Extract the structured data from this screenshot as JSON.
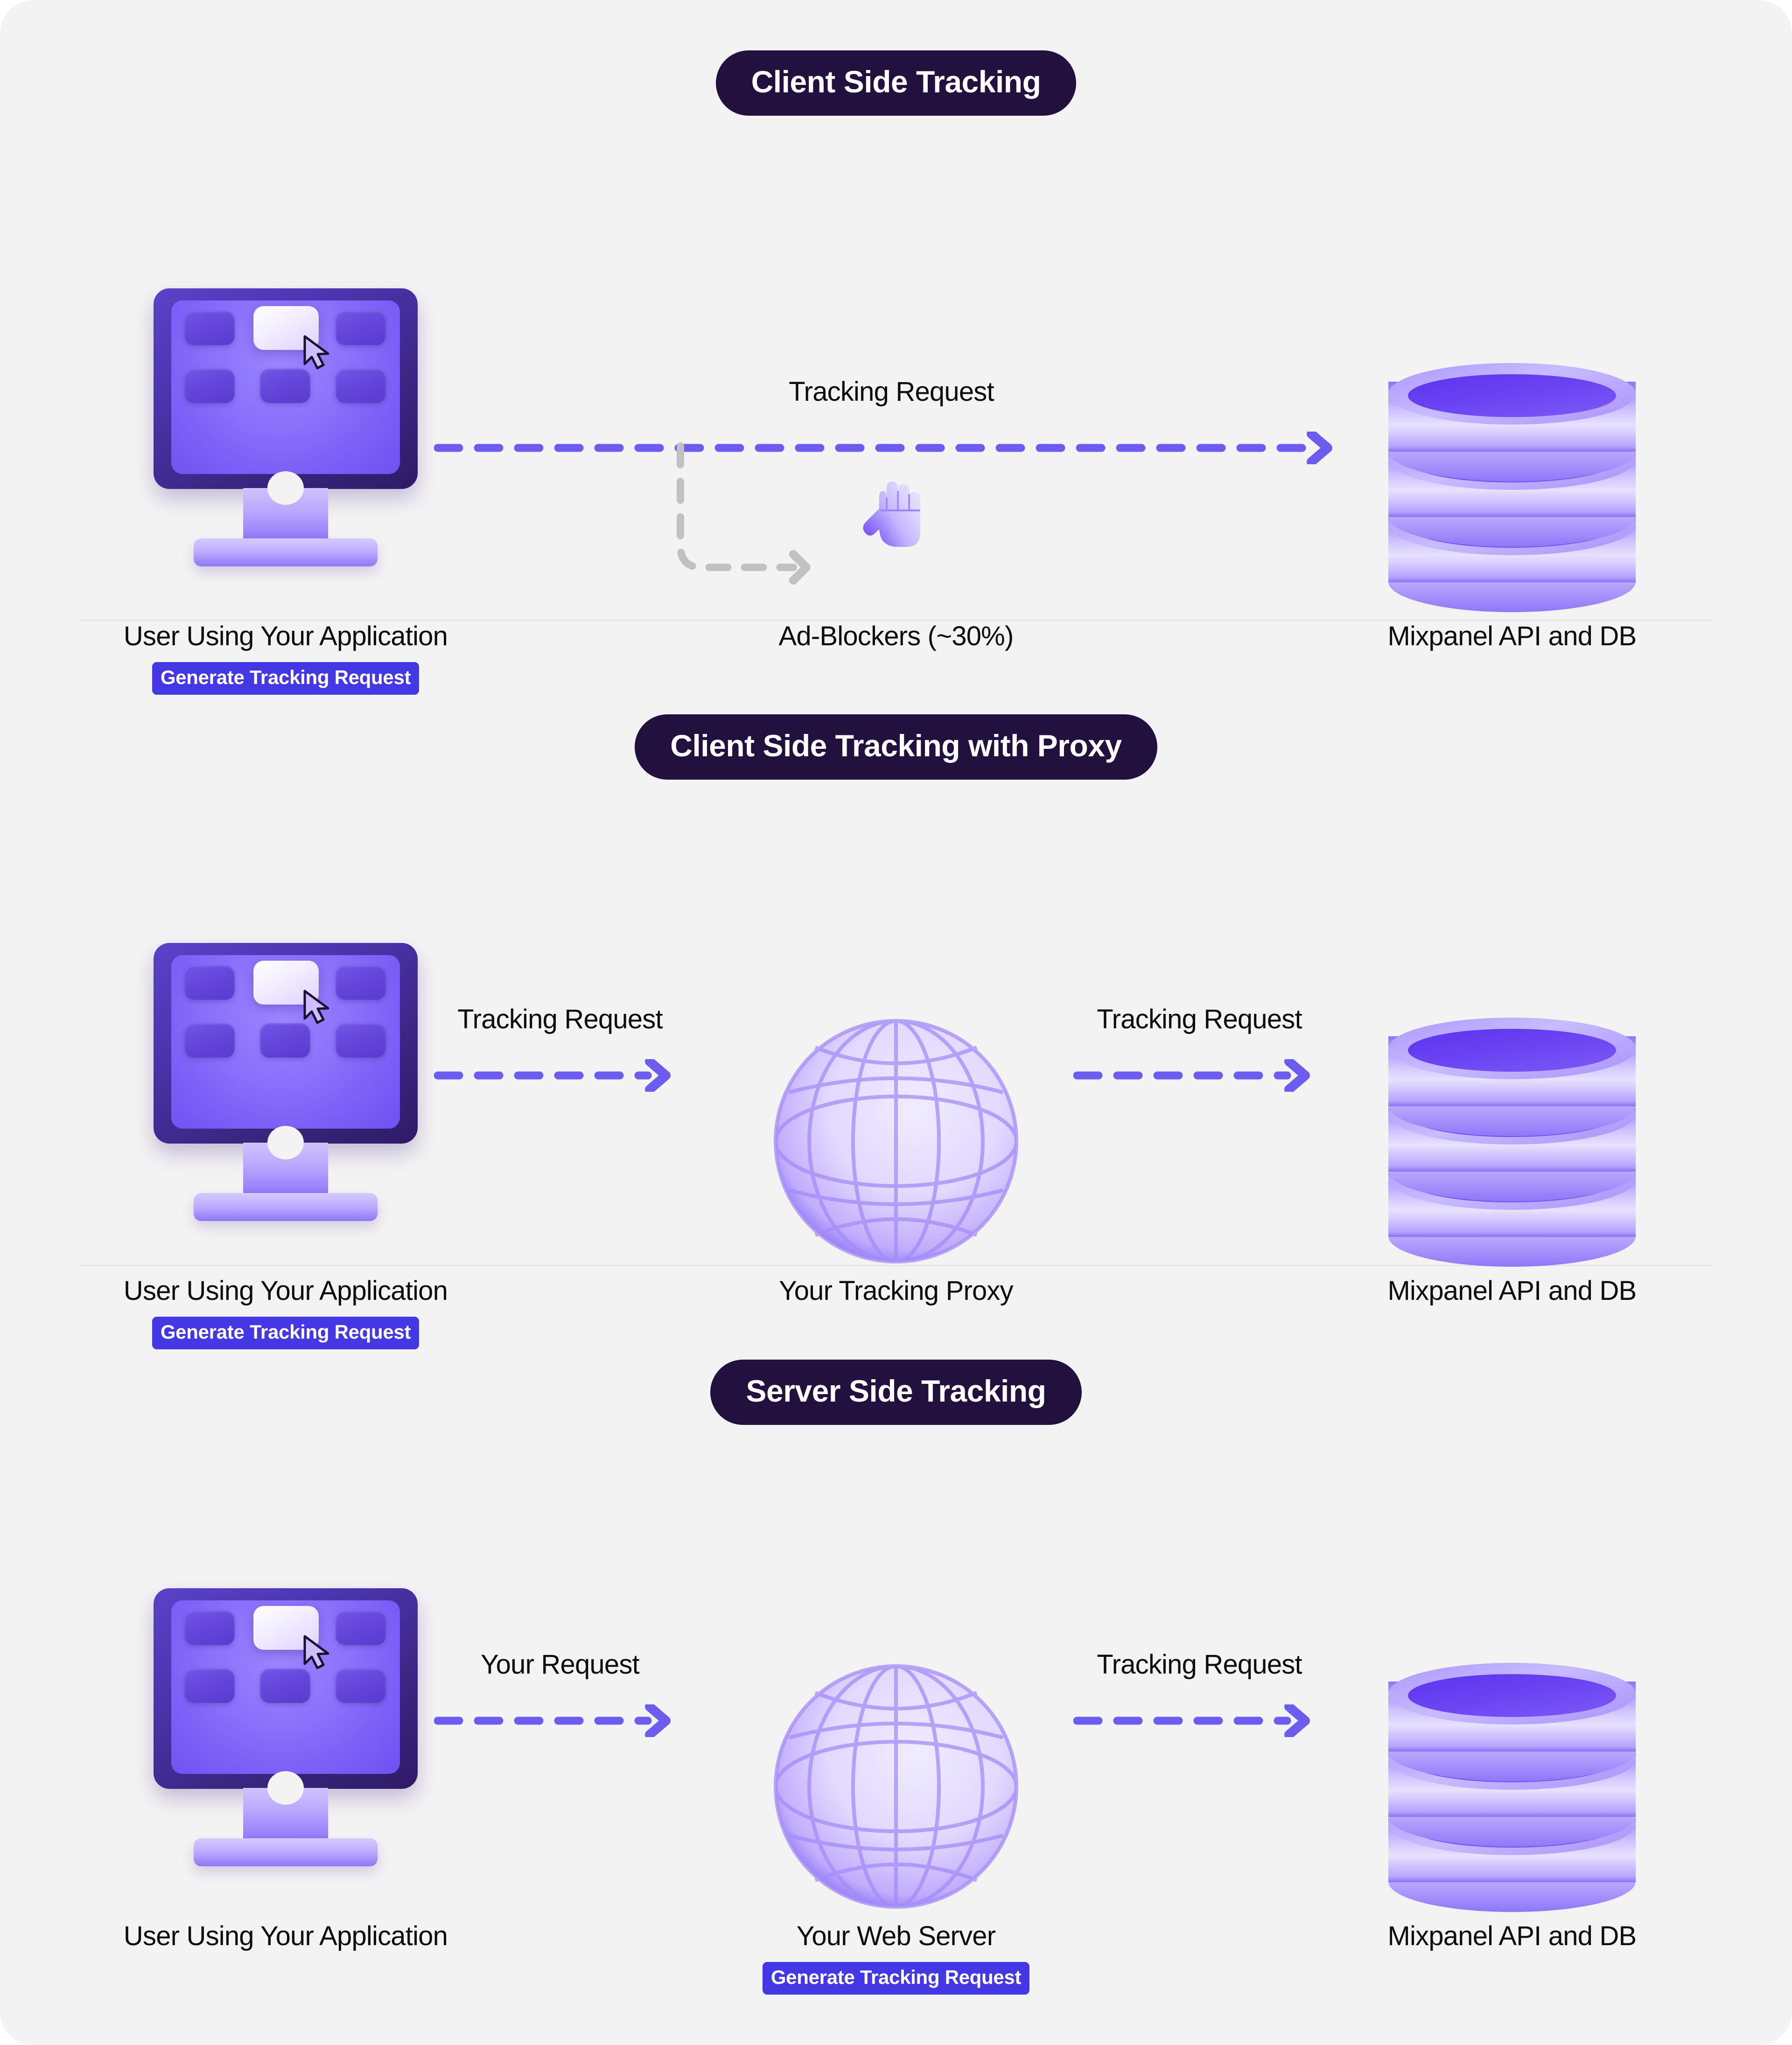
{
  "page": {
    "background": "#f4f3f4",
    "accent_purple": "#6d5cf0",
    "badge_color": "#4338e3",
    "pill_color": "#22113f",
    "gray_arrow_color": "#c2c0c2",
    "text_color": "#0d0d0d"
  },
  "sections": [
    {
      "title": "Client Side Tracking",
      "nodes": {
        "left": {
          "icon": "monitor-icon",
          "label": "User Using Your Application",
          "badge": "Generate Tracking Request"
        },
        "middle": {
          "icon": "stop-hand-icon",
          "label": "Ad-Blockers (~30%)",
          "badge": null
        },
        "right": {
          "icon": "database-icon",
          "label": "Mixpanel API and DB",
          "badge": null
        }
      },
      "arrows": [
        {
          "label": "Tracking Request",
          "style": "dashed-purple",
          "span": "left-to-right"
        },
        {
          "label": "",
          "style": "dashed-gray-branch",
          "span": "branch-to-adblocker"
        }
      ]
    },
    {
      "title": "Client Side Tracking with Proxy",
      "nodes": {
        "left": {
          "icon": "monitor-icon",
          "label": "User Using Your Application",
          "badge": "Generate Tracking Request"
        },
        "middle": {
          "icon": "globe-icon",
          "label": "Your Tracking Proxy",
          "badge": null
        },
        "right": {
          "icon": "database-icon",
          "label": "Mixpanel API and DB",
          "badge": null
        }
      },
      "arrows": [
        {
          "label": "Tracking Request",
          "style": "dashed-purple",
          "span": "left-to-middle"
        },
        {
          "label": "Tracking Request",
          "style": "dashed-purple",
          "span": "middle-to-right"
        }
      ]
    },
    {
      "title": "Server Side Tracking",
      "nodes": {
        "left": {
          "icon": "monitor-icon",
          "label": "User Using Your Application",
          "badge": null
        },
        "middle": {
          "icon": "globe-icon",
          "label": "Your Web Server",
          "badge": "Generate Tracking Request"
        },
        "right": {
          "icon": "database-icon",
          "label": "Mixpanel API and DB",
          "badge": null
        }
      },
      "arrows": [
        {
          "label": "Your Request",
          "style": "dashed-purple",
          "span": "left-to-middle"
        },
        {
          "label": "Tracking Request",
          "style": "dashed-purple",
          "span": "middle-to-right"
        }
      ]
    }
  ]
}
